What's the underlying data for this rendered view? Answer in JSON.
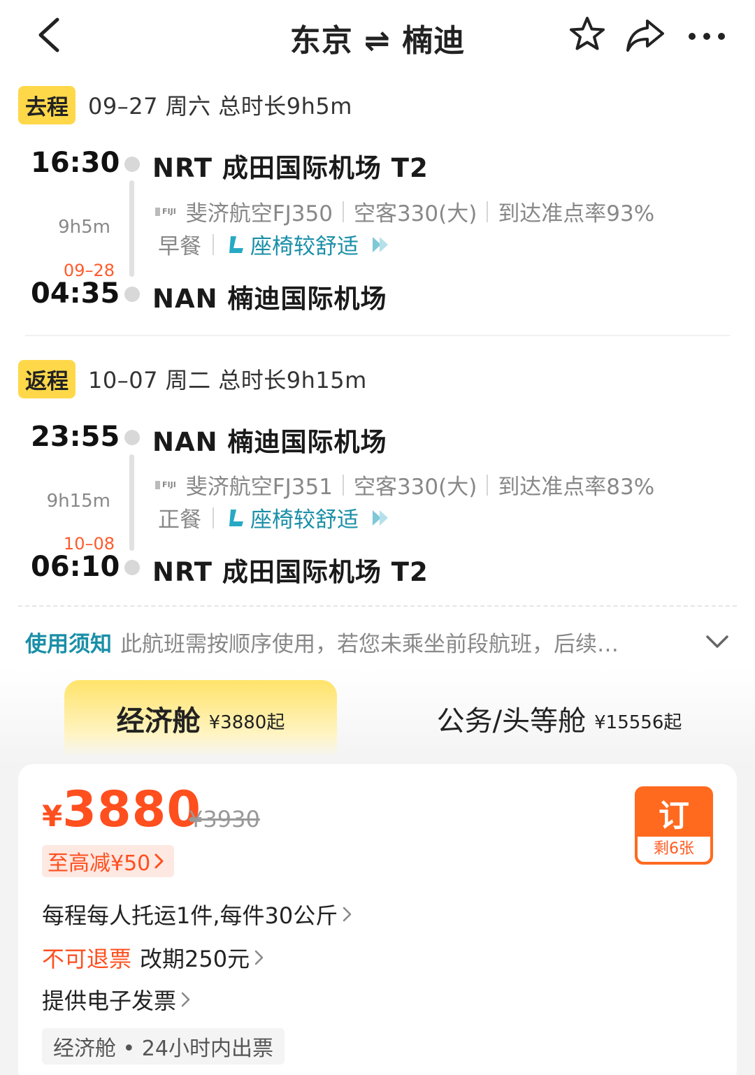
{
  "header": {
    "title": "东京 ⇌ 楠迪",
    "icons": [
      "back-icon",
      "star-icon",
      "share-icon",
      "more-icon"
    ]
  },
  "outbound": {
    "tag": "去程",
    "info": "09–27  周六  总时长9h5m",
    "depart_time": "16:30",
    "depart_airport": "NRT 成田国际机场 T2",
    "duration": "9h5m",
    "airline_logo": "FIJI",
    "flight": "斐济航空FJ350",
    "aircraft": "空客330(大)",
    "ontime": "到达准点率93%",
    "meal": "早餐",
    "comfort": "座椅较舒适",
    "arrive_date": "09–28",
    "arrive_time": "04:35",
    "arrive_airport": "NAN 楠迪国际机场"
  },
  "return": {
    "tag": "返程",
    "info": "10–07  周二  总时长9h15m",
    "depart_time": "23:55",
    "depart_airport": "NAN 楠迪国际机场",
    "duration": "9h15m",
    "airline_logo": "FIJI",
    "flight": "斐济航空FJ351",
    "aircraft": "空客330(大)",
    "ontime": "到达准点率83%",
    "meal": "正餐",
    "comfort": "座椅较舒适",
    "arrive_date": "10–08",
    "arrive_time": "06:10",
    "arrive_airport": "NRT 成田国际机场 T2"
  },
  "notice": {
    "label": "使用须知",
    "text": "此航班需按顺序使用，若您未乘坐前段航班，后续…"
  },
  "cabins": [
    {
      "name": "经济舱",
      "price": "¥3880起",
      "active": true
    },
    {
      "name": "公务/头等舱",
      "price": "¥15556起",
      "active": false
    }
  ],
  "offer": {
    "currency": "¥",
    "price": "3880",
    "original_price": "¥3930",
    "discount": "至高减¥50",
    "book_label": "订",
    "remaining": "剩6张",
    "baggage": "每程每人托运1件,每件30公斤",
    "refund": "不可退票",
    "change": "改期250元",
    "invoice": "提供电子发票",
    "cabin_info": "经济舱 • 24小时内出票"
  },
  "colors": {
    "accent_yellow": "#ffd84a",
    "price_orange": "#ff4f1f",
    "link_teal": "#1a8fa8"
  }
}
